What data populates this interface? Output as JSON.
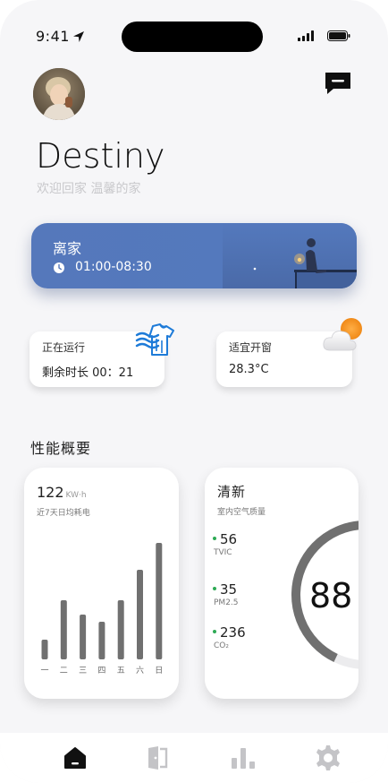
{
  "status": {
    "time": "9:41"
  },
  "profile": {
    "name": "Destiny",
    "welcome": "欢迎回家 温馨的家"
  },
  "mode": {
    "title": "离家",
    "time_range": "01:00-08:30"
  },
  "running": {
    "label": "正在运行",
    "remaining": "剩余时长  00：21"
  },
  "window": {
    "label": "适宜开窗",
    "temperature": "28.3°C"
  },
  "section": {
    "title": "性能概要"
  },
  "energy": {
    "value": "122",
    "unit": "KW·h",
    "description": "近7天日均耗电"
  },
  "chart_data": {
    "type": "bar",
    "categories": [
      "一",
      "二",
      "三",
      "四",
      "五",
      "六",
      "日"
    ],
    "values": [
      22,
      66,
      50,
      42,
      66,
      100,
      130
    ],
    "title": "",
    "xlabel": "",
    "ylabel": "",
    "ylim": [
      0,
      140
    ],
    "color": "#707070"
  },
  "air": {
    "title": "清新",
    "description": "室内空气质量",
    "score": "88",
    "score_fraction": 0.68,
    "metrics": [
      {
        "value": "56",
        "name": "TVIC"
      },
      {
        "value": "35",
        "name": "PM2.5"
      },
      {
        "value": "236",
        "name": "CO₂"
      }
    ],
    "dot_color": "#2eaa55"
  },
  "tabs": [
    {
      "icon": "home-icon",
      "active": true
    },
    {
      "icon": "door-icon",
      "active": false
    },
    {
      "icon": "stats-icon",
      "active": false
    },
    {
      "icon": "settings-icon",
      "active": false
    }
  ],
  "colors": {
    "mode_card": "#5578bb",
    "accent_blue": "#1e7bd8",
    "sun": "#f39223"
  }
}
